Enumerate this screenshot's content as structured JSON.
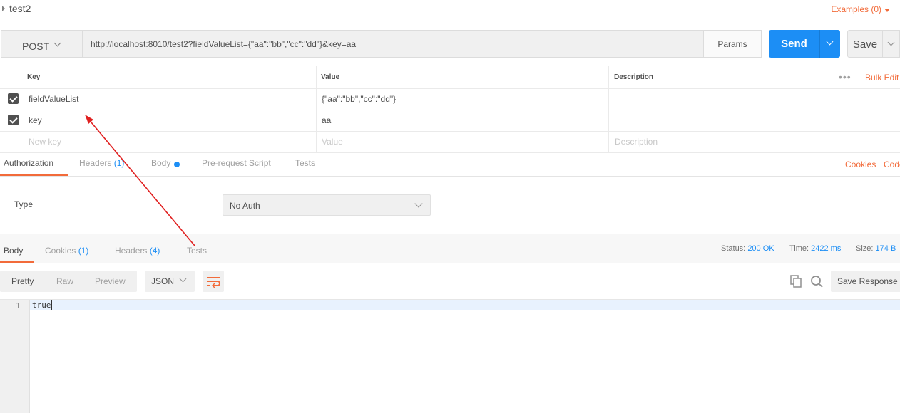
{
  "request": {
    "name": "test2",
    "examples_label": "Examples (0)"
  },
  "url_bar": {
    "method": "POST",
    "url": "http://localhost:8010/test2?fieldValueList={\"aa\":\"bb\",\"cc\":\"dd\"}&key=aa",
    "params_label": "Params",
    "send_label": "Send",
    "save_label": "Save"
  },
  "params_table": {
    "headers": {
      "key": "Key",
      "value": "Value",
      "description": "Description"
    },
    "more_label": "•••",
    "bulk_edit_label": "Bulk Edit",
    "rows": [
      {
        "checked": true,
        "key": "fieldValueList",
        "value": "{\"aa\":\"bb\",\"cc\":\"dd\"}",
        "description": ""
      },
      {
        "checked": true,
        "key": "key",
        "value": "aa",
        "description": ""
      }
    ],
    "new_row": {
      "key_placeholder": "New key",
      "value_placeholder": "Value",
      "description_placeholder": "Description"
    }
  },
  "request_tabs": {
    "authorization": "Authorization",
    "headers": "Headers",
    "headers_count": "(1)",
    "body": "Body",
    "prerequest": "Pre-request Script",
    "tests": "Tests",
    "cookies": "Cookies",
    "code": "Code",
    "active": "Authorization"
  },
  "auth": {
    "type_label": "Type",
    "type_value": "No Auth"
  },
  "response_tabs": {
    "body": "Body",
    "cookies": "Cookies",
    "cookies_count": "(1)",
    "headers": "Headers",
    "headers_count": "(4)",
    "tests": "Tests",
    "active": "Body"
  },
  "response_meta": {
    "status_label": "Status:",
    "status_value": "200 OK",
    "time_label": "Time:",
    "time_value": "2422 ms",
    "size_label": "Size:",
    "size_value": "174 B"
  },
  "response_toolbar": {
    "pretty": "Pretty",
    "raw": "Raw",
    "preview": "Preview",
    "format": "JSON",
    "save_response": "Save Response"
  },
  "response_body": {
    "line_number": "1",
    "content": "true"
  },
  "colors": {
    "accent_orange": "#f26b3a",
    "send_blue": "#1c8ef5",
    "annotation_arrow": "#e02020"
  },
  "icons": {
    "expand": "triangle-right-icon",
    "dropdown": "chevron-down-icon",
    "wrap": "wrap-lines-icon",
    "copy": "copy-icon",
    "search": "search-icon",
    "checkbox": "checkbox-checked-icon"
  }
}
